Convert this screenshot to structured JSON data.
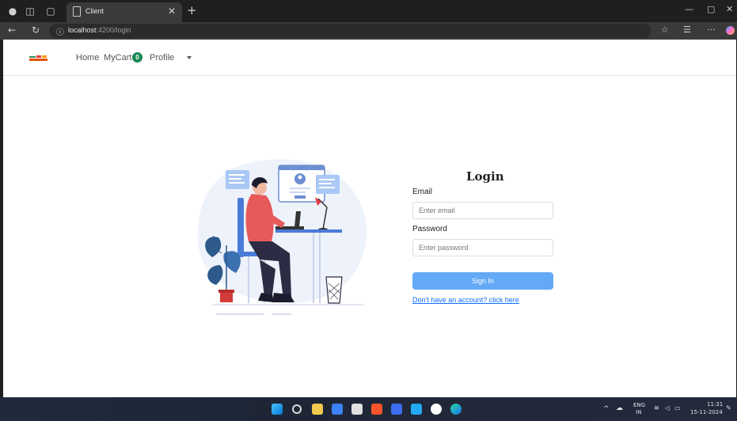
{
  "browser": {
    "tab_title": "Client",
    "url_host": "localhost",
    "url_path": ":4200/login",
    "icons": [
      "profile-icon",
      "workspaces-icon",
      "tab-actions-icon",
      "back-icon",
      "refresh-icon",
      "info-icon",
      "favorite-icon",
      "favorites-bar-icon",
      "more-icon",
      "copilot-icon"
    ]
  },
  "navbar": {
    "home": "Home",
    "mycart": "MyCart",
    "cart_count": "0",
    "profile": "Profile"
  },
  "login": {
    "title": "Login",
    "email_label": "Email",
    "email_placeholder": "Enter email",
    "password_label": "Password",
    "password_placeholder": "Enter password",
    "submit_label": "Sign In",
    "register_link": "Don't have an account? click here"
  },
  "taskbar": {
    "lang_top": "ENG",
    "lang_bottom": "IN",
    "time": "11:31",
    "date": "15-11-2024"
  },
  "colors": {
    "primary": "#64a9f5",
    "badge": "#198754",
    "link": "#0d6efd",
    "chrome_dark": "#1f1f1f",
    "chrome_mid": "#3a3a3a"
  }
}
